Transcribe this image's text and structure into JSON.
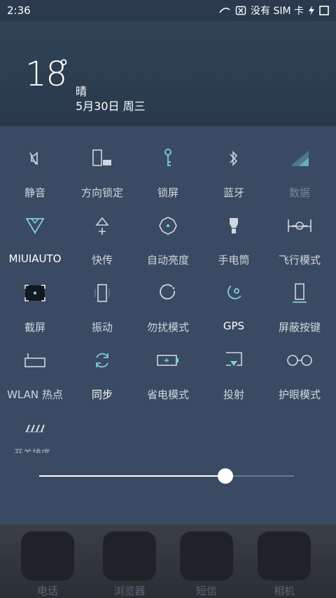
{
  "status_bar": {
    "time": "2:36",
    "carrier": "没有 SIM 卡",
    "icons": [
      "data-arrow-icon",
      "sim-x-icon",
      "charging-icon",
      "battery-outline-icon"
    ]
  },
  "weather": {
    "temperature": "18",
    "degree_symbol": "°",
    "condition": "晴",
    "date": "5月30日 周三"
  },
  "toggles": [
    {
      "label": "静音",
      "icon": "silent-icon",
      "state": "off"
    },
    {
      "label": "方向锁定",
      "icon": "rotation-lock-icon",
      "state": "off"
    },
    {
      "label": "锁屏",
      "icon": "lock-screen-icon",
      "state": "on"
    },
    {
      "label": "蓝牙",
      "icon": "bluetooth-icon",
      "state": "off"
    },
    {
      "label": "数据",
      "icon": "mobile-data-icon",
      "state": "disabled"
    },
    {
      "label": "MIUIAUTO",
      "icon": "miui-auto-icon",
      "state": "on"
    },
    {
      "label": "快传",
      "icon": "quick-transfer-icon",
      "state": "off"
    },
    {
      "label": "自动亮度",
      "icon": "auto-brightness-icon",
      "state": "off"
    },
    {
      "label": "手电筒",
      "icon": "flashlight-icon",
      "state": "off"
    },
    {
      "label": "飞行模式",
      "icon": "airplane-mode-icon",
      "state": "off"
    },
    {
      "label": "截屏",
      "icon": "screenshot-icon",
      "state": "on"
    },
    {
      "label": "振动",
      "icon": "vibrate-icon",
      "state": "off"
    },
    {
      "label": "勿扰模式",
      "icon": "do-not-disturb-icon",
      "state": "off"
    },
    {
      "label": "GPS",
      "icon": "gps-icon",
      "state": "on"
    },
    {
      "label": "屏蔽按键",
      "icon": "block-keys-icon",
      "state": "off"
    },
    {
      "label": "WLAN 热点",
      "icon": "wlan-hotspot-icon",
      "state": "off"
    },
    {
      "label": "同步",
      "icon": "sync-icon",
      "state": "on"
    },
    {
      "label": "省电模式",
      "icon": "battery-saver-icon",
      "state": "off"
    },
    {
      "label": "投射",
      "icon": "cast-icon",
      "state": "off"
    },
    {
      "label": "护眼模式",
      "icon": "eye-care-icon",
      "state": "off"
    },
    {
      "label": "",
      "icon": "edit-toggles-icon",
      "state": "off"
    }
  ],
  "sort_label": "开关排序",
  "brightness": {
    "value": 0.73
  },
  "colors": {
    "accent": "#7fd0d6",
    "panel": "#3b4a63",
    "weather_bg": "#2d3e52"
  },
  "dock": [
    {
      "label": "电话",
      "icon": "phone-app-icon"
    },
    {
      "label": "浏览器",
      "icon": "browser-app-icon"
    },
    {
      "label": "短信",
      "icon": "messages-app-icon"
    },
    {
      "label": "相机",
      "icon": "camera-app-icon"
    }
  ]
}
